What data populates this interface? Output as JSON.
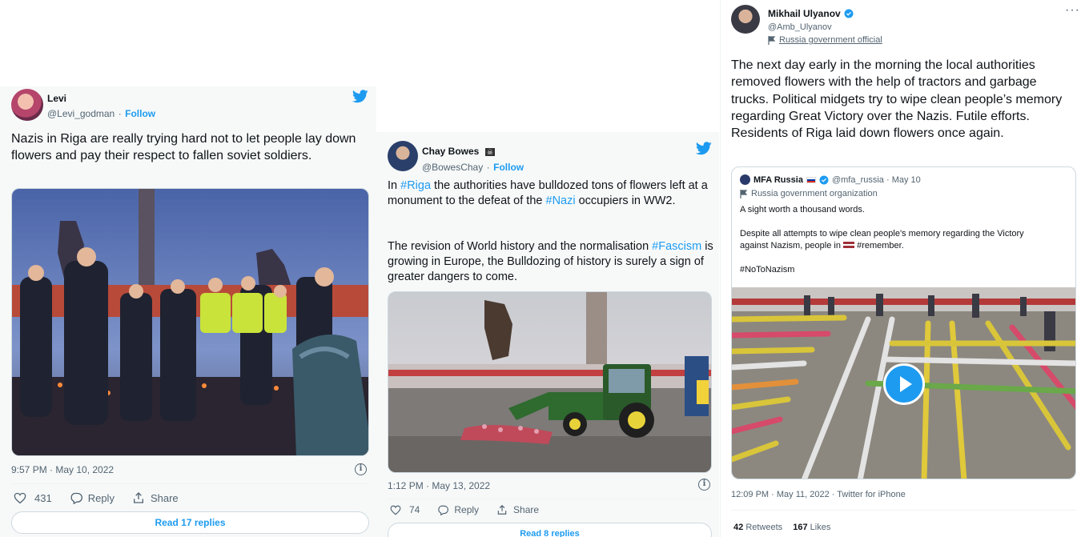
{
  "tweet1": {
    "name": "Levi",
    "handle": "@Levi_godman",
    "sep": "·",
    "follow": "Follow",
    "text": "Nazis in Riga are really trying hard not to let people lay down flowers and pay their respect to fallen soviet soldiers.",
    "timestamp": "9:57 PM · May 10, 2022",
    "likes": "431",
    "reply": "Reply",
    "share": "Share",
    "read_replies": "Read 17 replies"
  },
  "tweet2": {
    "name": "Chay Bowes",
    "flag_badge": "☠",
    "handle": "@BowesChay",
    "sep": "·",
    "follow": "Follow",
    "p1_a": "In ",
    "p1_tag1": "#Riga",
    "p1_b": " the authorities have bulldozed tons of flowers left at a monument to the defeat of the ",
    "p1_tag2": "#Nazi",
    "p1_c": " occupiers in WW2.",
    "p2_a": "The revision of World history and the normalisation ",
    "p2_tag": "#Fascism",
    "p2_b": " is growing in Europe, the Bulldozing of history is surely a sign of greater dangers  to come.",
    "timestamp": "1:12 PM · May 13, 2022",
    "likes": "74",
    "reply": "Reply",
    "share": "Share",
    "read_replies": "Read 8 replies"
  },
  "tweet3": {
    "name": "Mikhail Ulyanov",
    "handle": "@Amb_Ulyanov",
    "label": "Russia government official",
    "more": "···",
    "text": "The next day early in the morning the local authorities removed flowers with the help of tractors and garbage trucks. Political midgets try to wipe clean people’s memory regarding Great Victory over the Nazis. Futile efforts. Residents of Riga laid down flowers once again.",
    "quote": {
      "name": "MFA Russia",
      "handle_date": "@mfa_russia · May 10",
      "label": "Russia government organization",
      "line1": "A sight worth a thousand words.",
      "line2": "Despite all attempts to wipe clean people's memory regarding the Victory",
      "line3_a": "against Nazism, people in ",
      "line3_b": " #remember.",
      "line4": "#NoToNazism"
    },
    "timestamp": "12:09 PM · May 11, 2022 · Twitter for iPhone",
    "retweets_num": "42",
    "retweets_label": "Retweets",
    "likes_num": "167",
    "likes_label": "Likes"
  },
  "colors": {
    "accent": "#1d9bf0",
    "muted": "#536471",
    "text": "#0f1419"
  },
  "icons": [
    "twitter-bird-icon",
    "heart-icon",
    "reply-icon",
    "share-icon",
    "info-icon",
    "verified-icon",
    "government-flag-icon",
    "play-icon",
    "more-icon"
  ]
}
